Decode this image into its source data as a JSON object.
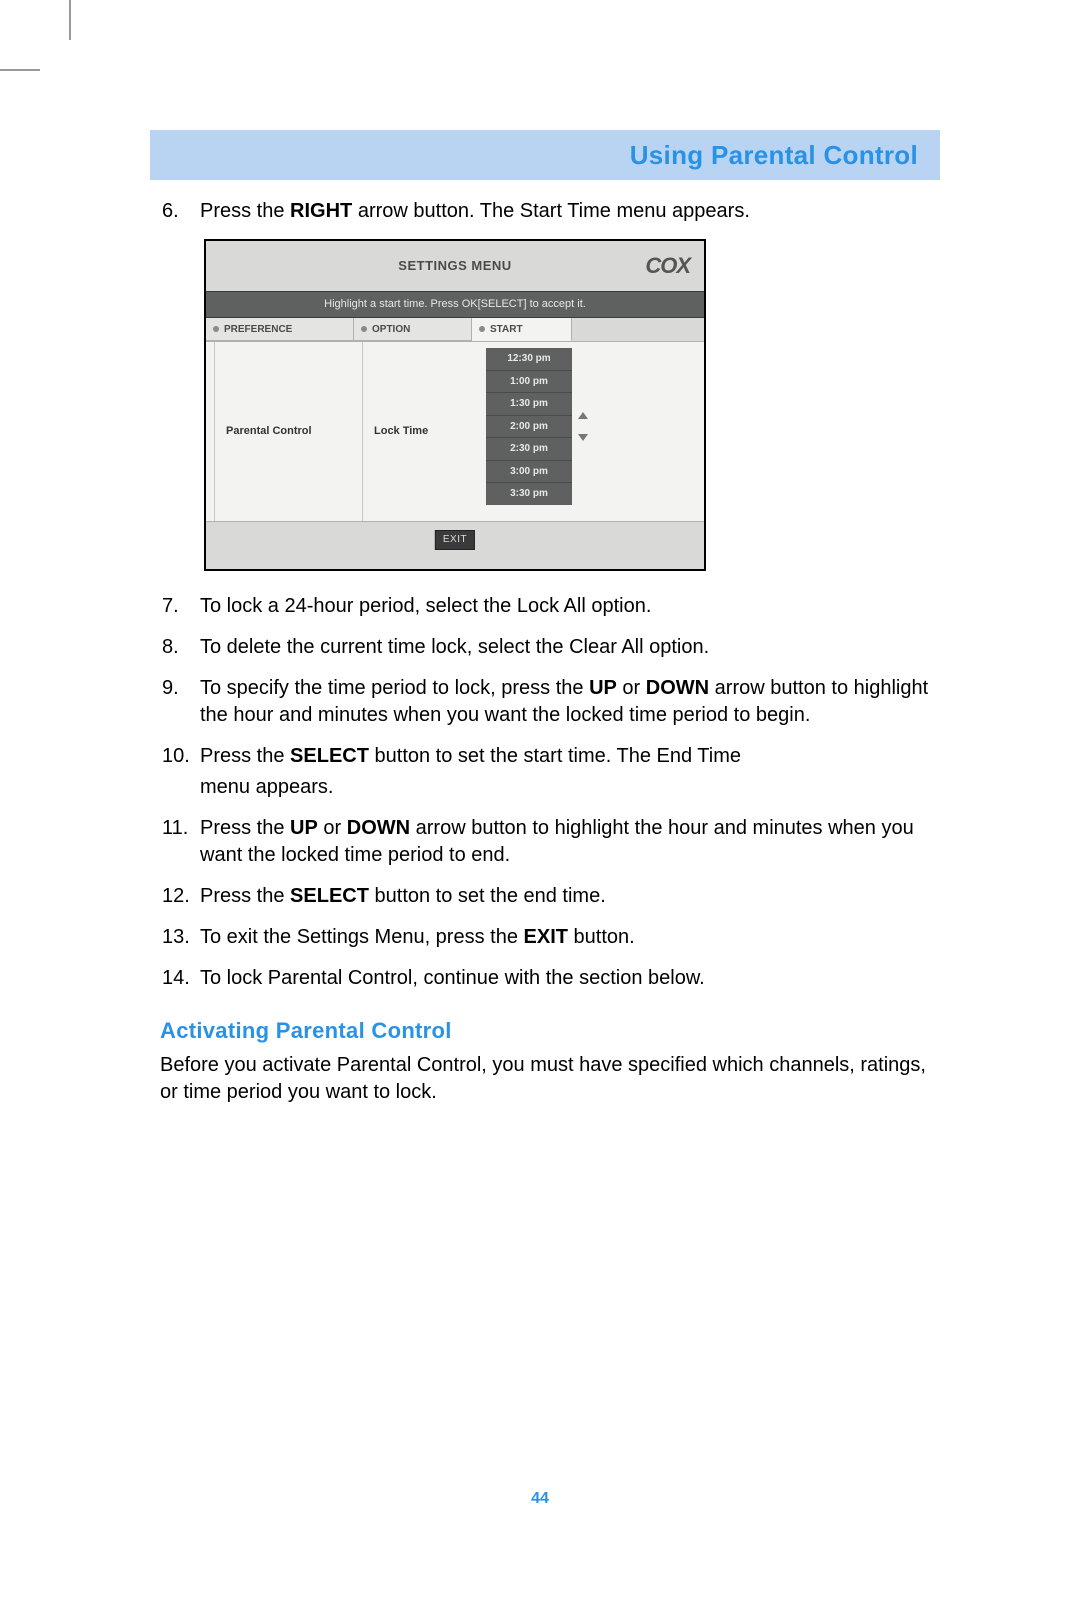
{
  "banner_title": "Using Parental Control",
  "page_number": "44",
  "shot": {
    "title": "SETTINGS MENU",
    "logo": "COX",
    "hint": "Highlight a start time.  Press OK[SELECT] to accept it.",
    "tabs": {
      "preference": "PREFERENCE",
      "option": "OPTION",
      "start": "START"
    },
    "pref_value": "Parental Control",
    "opt_value": "Lock Time",
    "times": [
      "12:30 pm",
      "1:00 pm",
      "1:30 pm",
      "2:00 pm",
      "2:30 pm",
      "3:00 pm",
      "3:30 pm"
    ],
    "exit": "EXIT"
  },
  "steps": {
    "s6": {
      "num": "6.",
      "a": "Press the ",
      "bold1": "RIGHT",
      "b": " arrow button. The Start Time menu appears."
    },
    "s7": {
      "num": "7.",
      "text": "To lock a 24-hour period, select the Lock All option."
    },
    "s8": {
      "num": "8.",
      "text": "To delete the current time lock, select the Clear All option."
    },
    "s9": {
      "num": "9.",
      "a": "To specify the time period to lock, press the ",
      "bold1": "UP",
      "b": " or ",
      "bold2": "DOWN",
      "c": " arrow button to highlight the hour and minutes when you want the locked time period to begin."
    },
    "s10": {
      "num": "10.",
      "a": "Press the ",
      "bold1": "SELECT",
      "b": " button to set the start time. The End Time",
      "c": "menu appears."
    },
    "s11": {
      "num": "11.",
      "a": "Press the ",
      "bold1": "UP",
      "b": " or ",
      "bold2": "DOWN",
      "c": " arrow button to highlight the hour and minutes when you want the locked time period to end."
    },
    "s12": {
      "num": "12.",
      "a": "Press the ",
      "bold1": "SELECT",
      "b": " button to set the end time."
    },
    "s13": {
      "num": "13.",
      "a": "To exit the Settings Menu, press the ",
      "bold1": "EXIT",
      "b": " button."
    },
    "s14": {
      "num": "14.",
      "text": "To lock Parental Control, continue with the section below."
    }
  },
  "section": {
    "heading": "Activating Parental Control",
    "body": "Before you activate Parental Control, you must have specified which channels, ratings, or time period you want to lock."
  }
}
